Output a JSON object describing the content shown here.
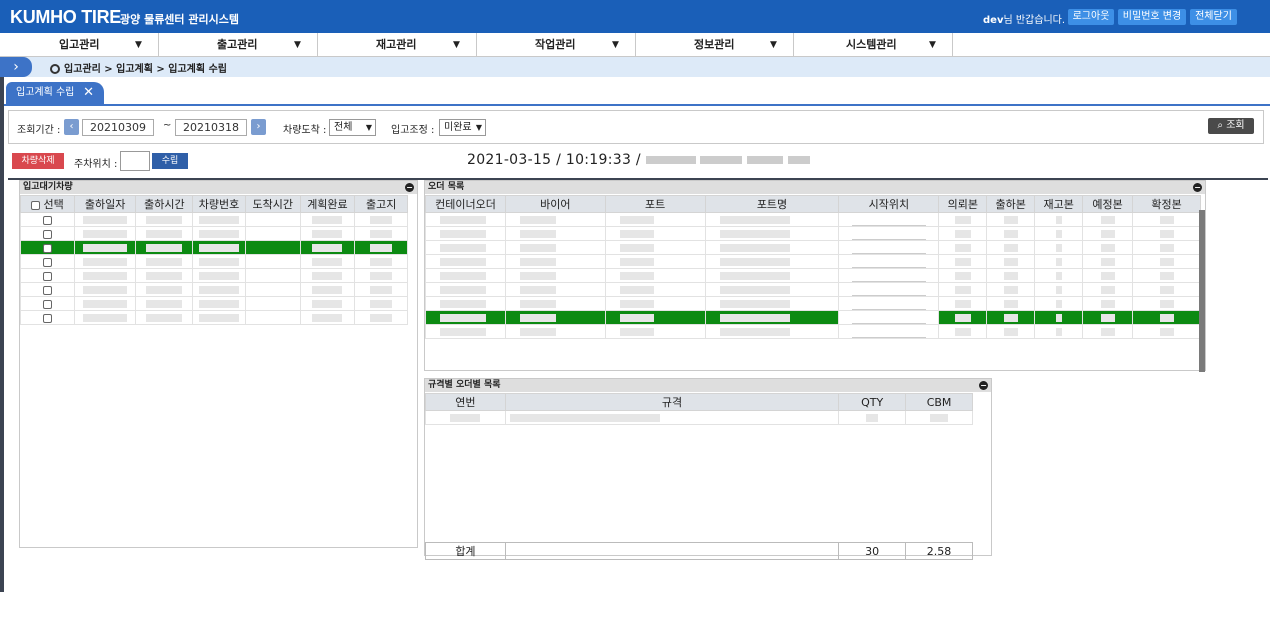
{
  "header": {
    "logo": "KUMHO TIRE",
    "system_title": "광양 물류센터 관리시스템",
    "user": "dev",
    "greeting": "님 반갑습니다.",
    "logout": "로그아웃",
    "change_pw": "비밀번호 변경",
    "close_all": "전체닫기"
  },
  "menu": [
    {
      "label": "입고관리"
    },
    {
      "label": "출고관리"
    },
    {
      "label": "재고관리"
    },
    {
      "label": "작업관리"
    },
    {
      "label": "정보관리"
    },
    {
      "label": "시스템관리"
    }
  ],
  "breadcrumb": "입고관리 > 입고계획 > 입고계획 수립",
  "tab": {
    "label": "입고계획 수립"
  },
  "filter": {
    "period_label": "조회기간 :",
    "date_from": "20210309",
    "tilde": "~",
    "date_to": "20210318",
    "arrival_label": "차량도착 :",
    "arrival_value": "전체",
    "adjust_label": "입고조정 :",
    "adjust_value": "미완료",
    "search_label": "조회"
  },
  "actions": {
    "delete_vehicle": "차량삭제",
    "parking_label": "주차위치 :",
    "establish": "수립",
    "datetime": "2021-03-15 / 10:19:33 /"
  },
  "left_panel": {
    "title": "입고대기차량",
    "columns": [
      "선택",
      "출하일자",
      "출하시간",
      "차량번호",
      "도착시간",
      "계획완료",
      "출고지"
    ],
    "row_count": 8,
    "highlight_row": 2
  },
  "order_panel": {
    "title": "오더 목록",
    "columns": [
      "컨테이너오더",
      "바이어",
      "포트",
      "포트명",
      "시작위치",
      "의뢰본",
      "출하본",
      "재고본",
      "예정본",
      "확정본"
    ],
    "row_count": 9,
    "highlight_row": 7
  },
  "spec_panel": {
    "title": "규격별 오더별 목록",
    "columns": [
      "연번",
      "규격",
      "QTY",
      "CBM"
    ],
    "total_label": "합계",
    "total_qty": "30",
    "total_cbm": "2.58"
  },
  "colors": {
    "header": "#1a5fb8",
    "highlight": "#0c8a12",
    "tab": "#3d73c7"
  }
}
